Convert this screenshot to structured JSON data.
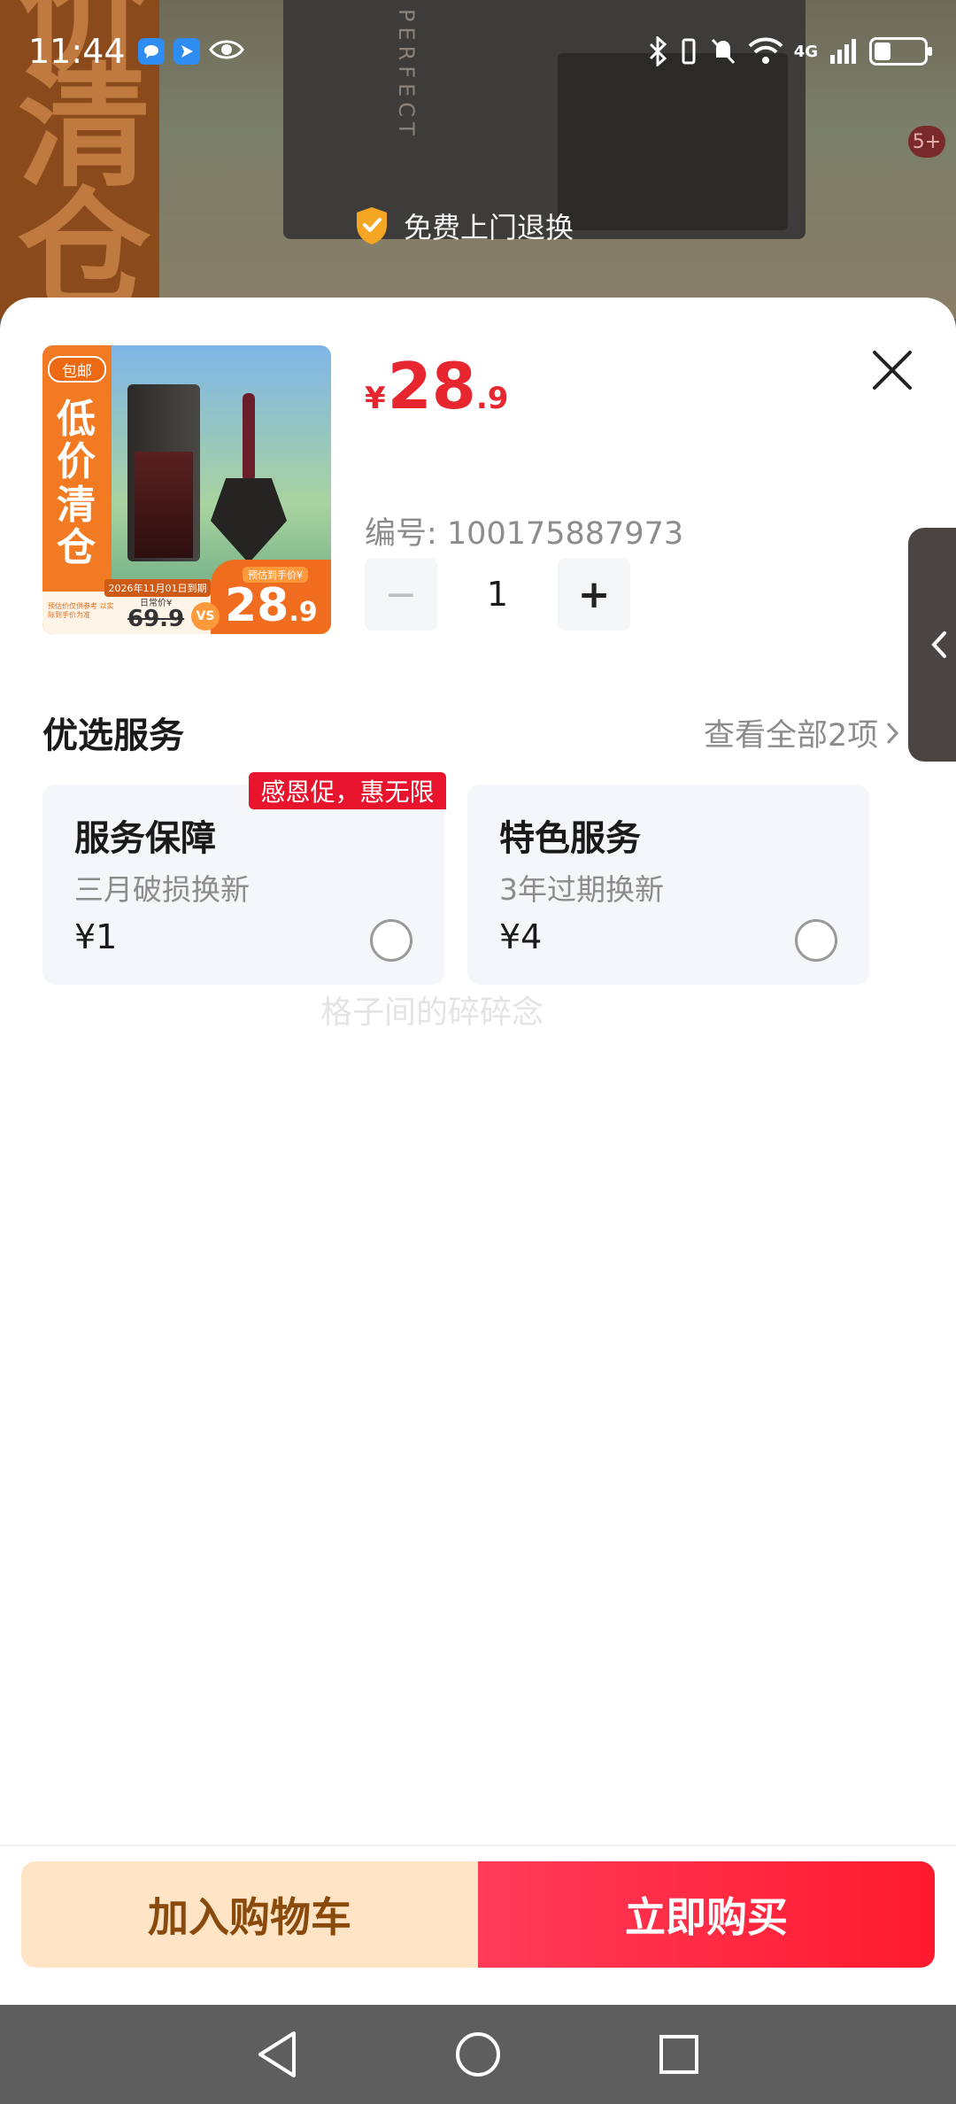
{
  "status_bar": {
    "time": "11:44",
    "network": "4G",
    "apps": [
      "message-icon",
      "location-icon",
      "eye-icon"
    ]
  },
  "background": {
    "big_chars": [
      "价",
      "清",
      "仓"
    ],
    "product_brand": "PERFECT",
    "badge": "5+",
    "return_service": "免费上门退换"
  },
  "product": {
    "thumb": {
      "tag": "包邮",
      "vertical_text": "低价清仓",
      "date": "2026年11月01日到期",
      "daily_price_label": "日常价¥",
      "daily_price": "69.9",
      "vs": "VS",
      "estimated_label": "预估到手价¥",
      "big_price_int": "28",
      "big_price_dec": ".9",
      "note": "预估价仅供参考 以实际到手价为准"
    },
    "price": {
      "symbol": "¥",
      "integer": "28",
      "decimal": ".9"
    },
    "sku": "编号: 100175887973",
    "quantity": {
      "minus": "−",
      "value": "1",
      "plus": "+"
    }
  },
  "services": {
    "title": "优选服务",
    "more": "查看全部2项",
    "promo_tag": "感恩促，惠无限",
    "cards": [
      {
        "name": "服务保障",
        "desc": "三月破损换新",
        "price": "¥1",
        "selected": false
      },
      {
        "name": "特色服务",
        "desc": "3年过期换新",
        "price": "¥4",
        "selected": false
      }
    ]
  },
  "watermark": "格子间的碎碎念",
  "actions": {
    "add_to_cart": "加入购物车",
    "buy_now": "立即购买"
  },
  "colors": {
    "price_red": "#e8262f",
    "buy_red": "#ff1a2e",
    "cart_bg": "#ffe4c6",
    "cart_text": "#8a4a0c",
    "promo_red": "#e8132c"
  }
}
